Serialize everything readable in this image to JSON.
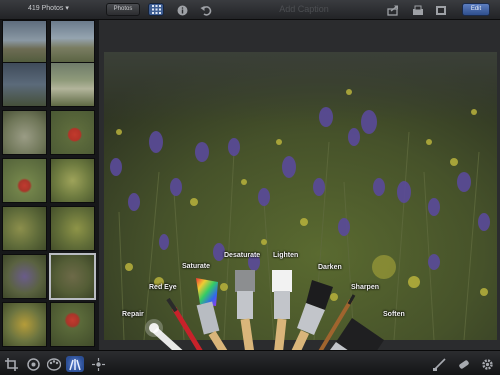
{
  "topbar": {
    "album_label": "419 Photos ▾",
    "photos_button": "Photos",
    "caption_placeholder": "Add Caption",
    "edit_button": "Edit"
  },
  "brushes": {
    "repair": "Repair",
    "red_eye": "Red Eye",
    "saturate": "Saturate",
    "desaturate": "Desaturate",
    "lighten": "Lighten",
    "darken": "Darken",
    "sharpen": "Sharpen",
    "soften": "Soften"
  },
  "icons": {
    "topbar": [
      "grid-icon",
      "info-icon",
      "undo-icon",
      "share-icon",
      "upload-icon",
      "gallery-icon"
    ],
    "bottombar": [
      "crop-icon",
      "exposure-icon",
      "color-icon",
      "brushes-icon",
      "effects-icon",
      "auto-enhance-icon",
      "remove-icon",
      "settings-icon"
    ]
  },
  "colors": {
    "accent": "#3d5d93",
    "edit_accent": "#4a6db0"
  }
}
